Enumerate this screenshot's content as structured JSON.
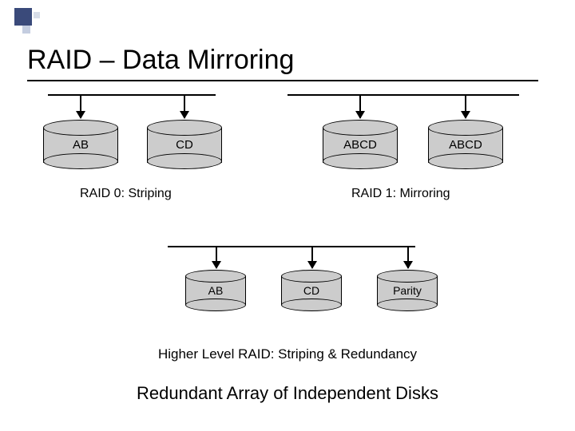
{
  "title": "RAID – Data Mirroring",
  "raid0": {
    "disks": [
      "AB",
      "CD"
    ],
    "label": "RAID 0: Striping"
  },
  "raid1": {
    "disks": [
      "ABCD",
      "ABCD"
    ],
    "label": "RAID 1: Mirroring"
  },
  "higher": {
    "disks": [
      "AB",
      "CD",
      "Parity"
    ],
    "label": "Higher Level RAID: Striping & Redundancy"
  },
  "footer": "Redundant Array of Independent Disks"
}
